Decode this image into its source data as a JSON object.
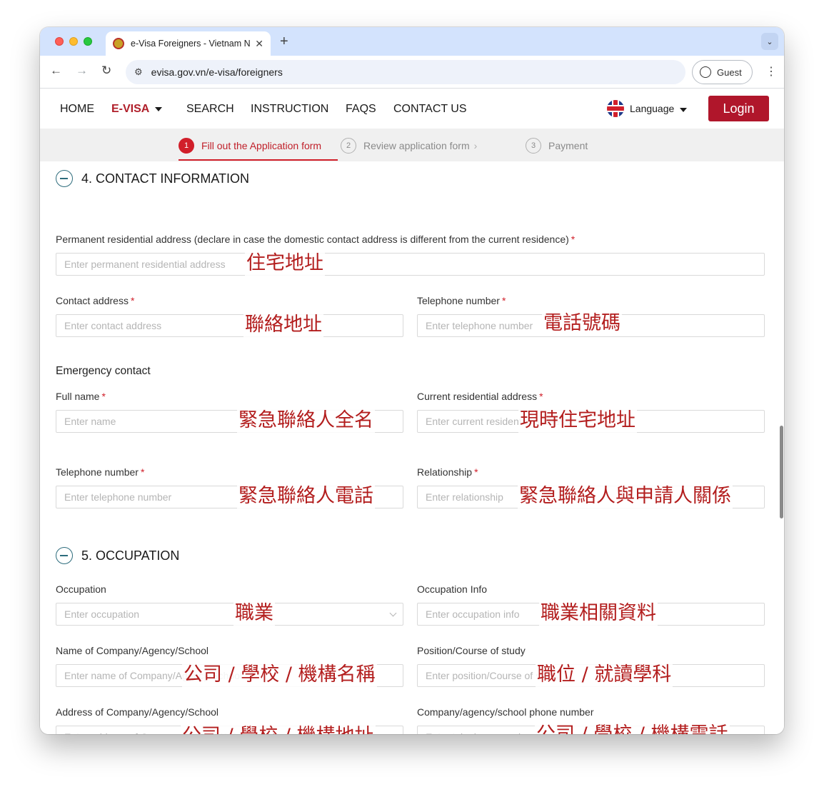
{
  "browser": {
    "tab_title": "e-Visa Foreigners - Vietnam N",
    "tab_close": "✕",
    "new_tab": "+",
    "tab_menu": "⌄",
    "url": "evisa.gov.vn/e-visa/foreigners",
    "profile_label": "Guest",
    "back": "←",
    "forward": "→",
    "reload": "↻",
    "site_settings": "⚙",
    "menu": "⋮"
  },
  "nav": {
    "items": [
      "HOME",
      "E-VISA",
      "SEARCH",
      "INSTRUCTION",
      "FAQS",
      "CONTACT US"
    ],
    "language": "Language",
    "login": "Login"
  },
  "steps": [
    {
      "num": "1",
      "label": "Fill out the Application form"
    },
    {
      "num": "2",
      "label": "Review application form",
      "chev": "›"
    },
    {
      "num": "3",
      "label": "Payment"
    }
  ],
  "section4": {
    "title": "4. CONTACT INFORMATION",
    "permanent_label": "Permanent residential address (declare in case the domestic contact address is different from the current residence)",
    "permanent_placeholder": "Enter permanent residential address",
    "contact_label": "Contact address",
    "contact_placeholder": "Enter contact address",
    "phone_label": "Telephone number",
    "phone_placeholder": "Enter telephone number",
    "emergency_title": "Emergency contact",
    "ec_name_label": "Full name",
    "ec_name_placeholder": "Enter name",
    "ec_current_label": "Current residential address",
    "ec_current_placeholder": "Enter current residential address",
    "ec_phone_label": "Telephone number",
    "ec_phone_placeholder": "Enter telephone number",
    "ec_rel_label": "Relationship",
    "ec_rel_placeholder": "Enter relationship"
  },
  "section5": {
    "title": "5. OCCUPATION",
    "occ_label": "Occupation",
    "occ_placeholder": "Enter occupation",
    "occinfo_label": "Occupation Info",
    "occinfo_placeholder": "Enter occupation info",
    "company_label": "Name of Company/Agency/School",
    "company_placeholder": "Enter name of Company/Agency/School",
    "position_label": "Position/Course of study",
    "position_placeholder": "Enter position/Course of study",
    "caddr_label": "Address of Company/Agency/School",
    "caddr_placeholder": "Enter address of Company/Agency/School",
    "cphone_label": "Company/agency/school phone number",
    "cphone_placeholder": "Enter telephone number"
  },
  "required_mark": "*",
  "annotations": {
    "permanent": "住宅地址",
    "contact": "聯絡地址",
    "phone": "電話號碼",
    "ec_name": "緊急聯絡人全名",
    "ec_current": "現時住宅地址",
    "ec_phone": "緊急聯絡人電話",
    "ec_rel": "緊急聯絡人與申請人關係",
    "occ": "職業",
    "occinfo": "職業相關資料",
    "company": "公司 / 學校 / 機構名稱",
    "position": "職位 / 就讀學科",
    "caddr": "公司 / 學校 / 機構地址",
    "cphone": "公司 / 學校 / 機構電話"
  },
  "colors": {
    "brand_red": "#b0162b",
    "active_step": "#d11f2a",
    "annotation": "#b31e1e",
    "section_icon": "#2d6c7c"
  }
}
